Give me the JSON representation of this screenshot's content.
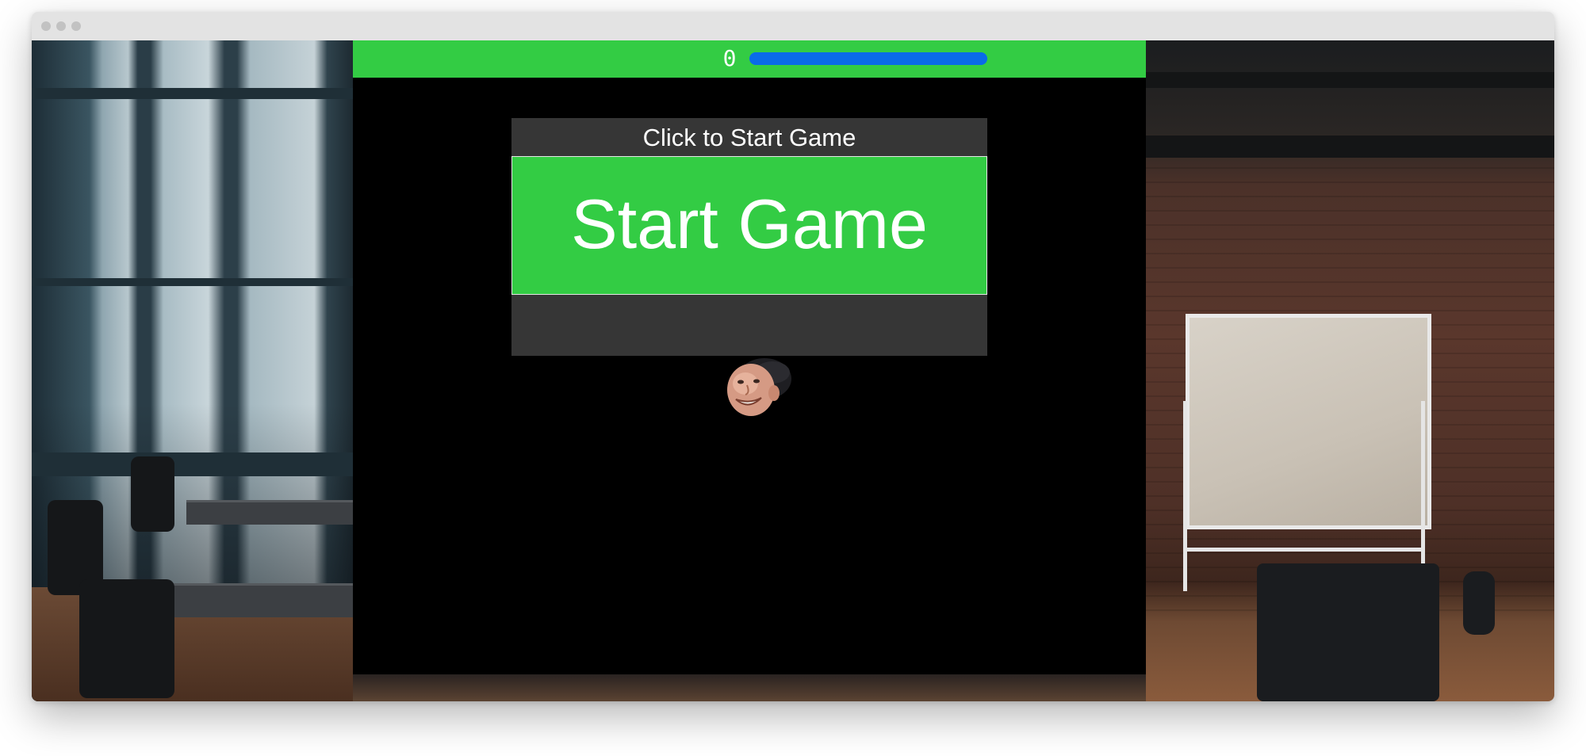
{
  "hud": {
    "score": "0",
    "health_fraction": 1.0,
    "health_color": "#0a6be8",
    "bar_color": "#33cc44"
  },
  "start_panel": {
    "title": "Click to Start Game",
    "button_label": "Start Game",
    "button_color": "#33cc44",
    "panel_color": "#363636"
  },
  "player": {
    "icon": "player-face-icon"
  },
  "game_background": "#000000"
}
